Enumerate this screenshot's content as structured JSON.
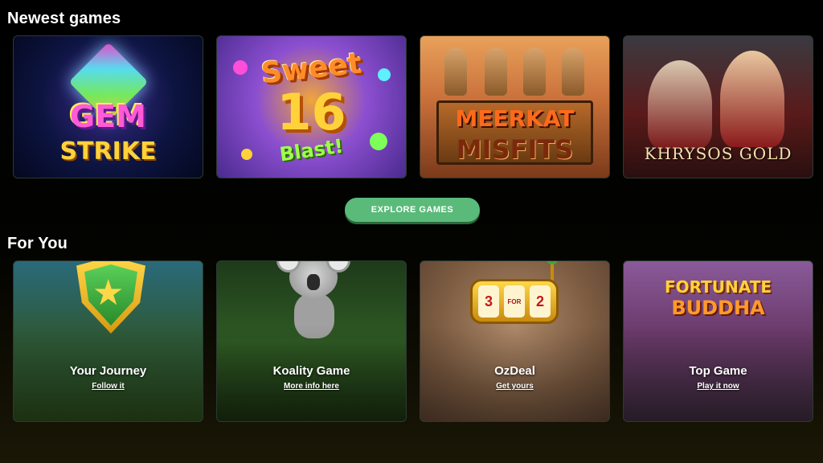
{
  "sections": {
    "newest": {
      "title": "Newest games"
    },
    "for_you": {
      "title": "For You"
    }
  },
  "newest_games": [
    {
      "title_line1": "GEM",
      "title_line2": "STRIKE"
    },
    {
      "title_line1": "Sweet",
      "title_number": "16",
      "title_line2": "Blast!"
    },
    {
      "title_line1": "MEERKAT",
      "title_line2": "MISFITS"
    },
    {
      "title_line1": "KHRYSOS GOLD"
    }
  ],
  "explore_button": {
    "label": "EXPLORE GAMES"
  },
  "for_you_cards": [
    {
      "label": "Your Journey",
      "link": "Follow it"
    },
    {
      "label": "Koality Game",
      "link": "More info here",
      "art": "koala"
    },
    {
      "label": "OzDeal",
      "link": "Get yours",
      "reels": [
        "3",
        "FOR",
        "2"
      ]
    },
    {
      "label": "Top Game",
      "link": "Play it now",
      "art_line1": "FORTUNATE",
      "art_line2": "BUDDHA"
    }
  ],
  "colors": {
    "accent_button": "#5aba7a",
    "background": "#000000"
  }
}
